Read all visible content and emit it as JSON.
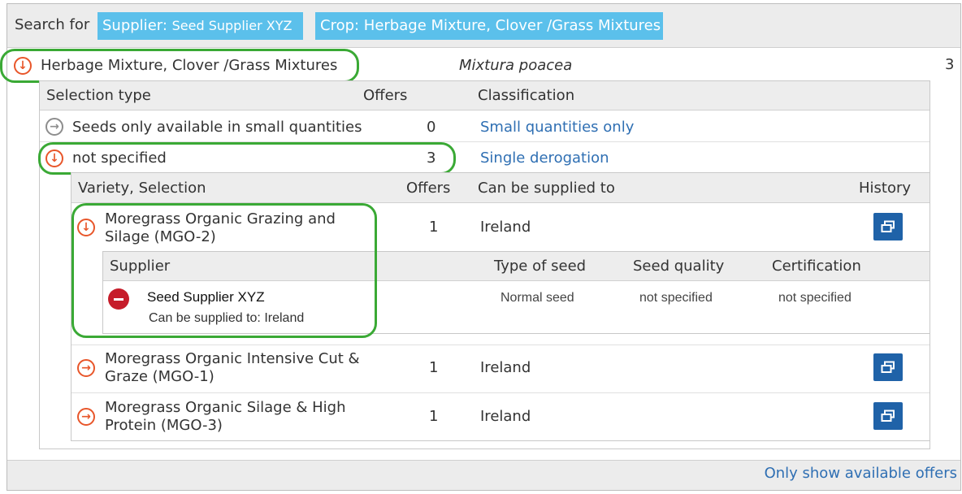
{
  "search": {
    "label": "Search for",
    "supplier_prefix": "Supplier: ",
    "supplier_value": "Seed Supplier XYZ",
    "crop_tag": "Crop: Herbage Mixture, Clover /Grass Mixtures"
  },
  "crop": {
    "name": "Herbage Mixture, Clover /Grass Mixtures",
    "latin": "Mixtura poacea",
    "count": "3"
  },
  "selection_table": {
    "headers": [
      "Selection type",
      "Offers",
      "Classification"
    ],
    "rows": [
      {
        "type": "Seeds only available in small quantities",
        "offers": "0",
        "classification": "Small quantities only"
      },
      {
        "type": "not specified",
        "offers": "3",
        "classification": "Single derogation"
      }
    ]
  },
  "variety_table": {
    "headers": [
      "Variety, Selection",
      "Offers",
      "Can be supplied to",
      "History"
    ],
    "rows": [
      {
        "name": "Moregrass Organic Grazing and Silage (MGO-2)",
        "name_line1": "Moregrass Organic Grazing and",
        "name_line2": "Silage (MGO-2)",
        "offers": "1",
        "supplied_to": "Ireland",
        "icon": "arrow-down-icon"
      },
      {
        "name": "Moregrass Organic Intensive Cut & Graze (MGO-1)",
        "name_line1": "Moregrass Organic Intensive Cut &",
        "name_line2": "Graze (MGO-1)",
        "offers": "1",
        "supplied_to": "Ireland",
        "icon": "arrow-right-icon"
      },
      {
        "name": "Moregrass Organic Silage & High Protein (MGO-3)",
        "name_line1": "Moregrass Organic Silage & High",
        "name_line2": "Protein (MGO-3)",
        "offers": "1",
        "supplied_to": "Ireland",
        "icon": "arrow-right-icon"
      }
    ]
  },
  "supplier_table": {
    "headers": [
      "Supplier",
      "Type of seed",
      "Seed quality",
      "Certification"
    ],
    "rows": [
      {
        "supplier": "Seed Supplier XYZ",
        "can_supply": "Can be supplied to: Ireland",
        "type_of_seed": "Normal seed",
        "seed_quality": "not specified",
        "certification": "not specified"
      }
    ]
  },
  "footer": {
    "only_available": "Only show available offers"
  },
  "colors": {
    "tag_bg": "#5bc0eb",
    "accent_orange": "#e8562a",
    "link_blue": "#2f6fb3",
    "button_blue": "#1f62a8",
    "highlight_green": "#3aa935",
    "remove_red": "#c61c2a"
  }
}
